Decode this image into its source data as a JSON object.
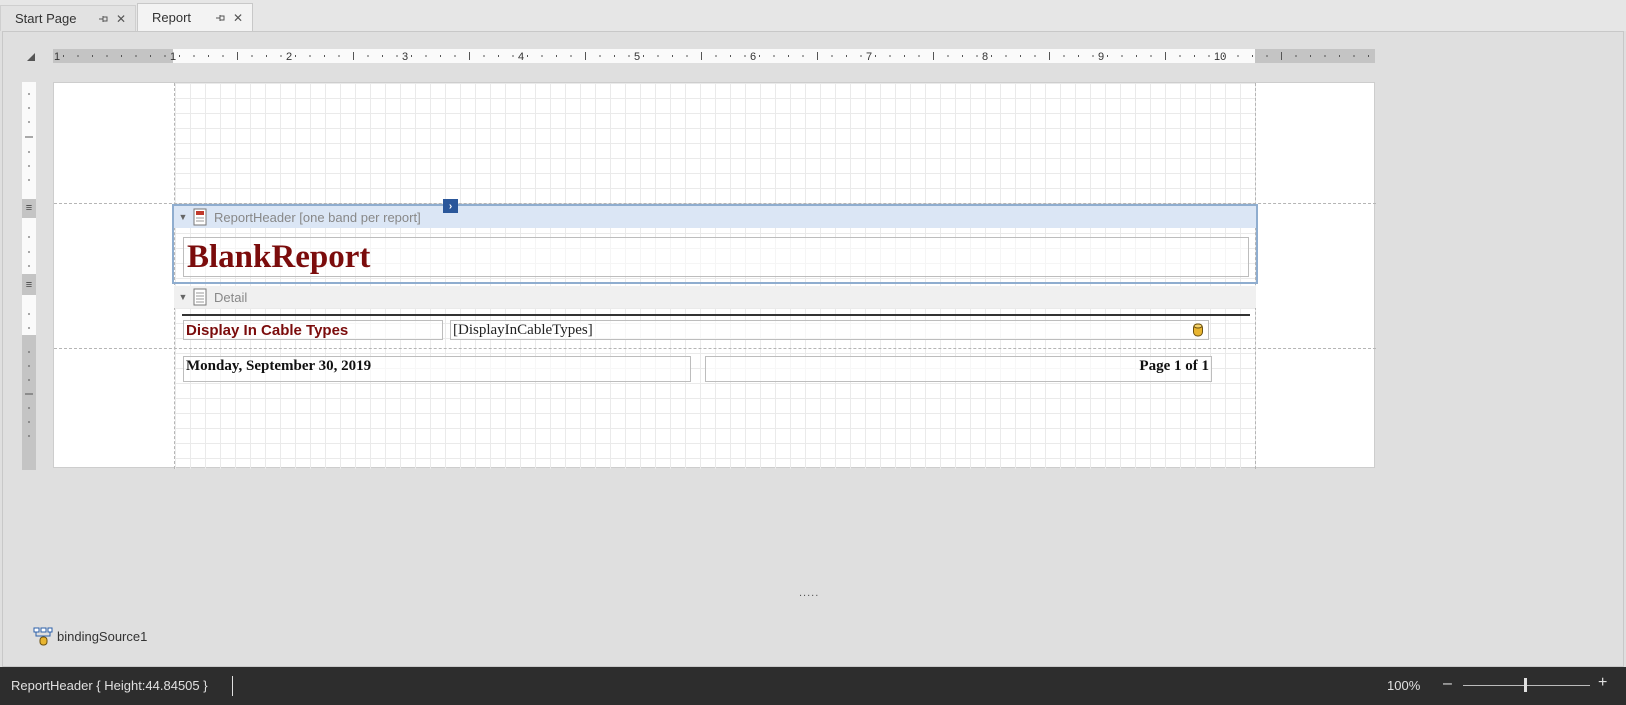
{
  "tabs": [
    {
      "label": "Start Page",
      "active": false
    },
    {
      "label": "Report",
      "active": true
    }
  ],
  "ruler": {
    "horizontal_numbers": [
      "1",
      "1",
      "2",
      "3",
      "4",
      "5",
      "6",
      "7",
      "8",
      "9",
      "10"
    ]
  },
  "bands": {
    "report_header": {
      "label": "ReportHeader [one band per report]"
    },
    "detail": {
      "label": "Detail"
    }
  },
  "report": {
    "title": "BlankReport",
    "caption": "Display In Cable Types",
    "field": "[DisplayInCableTypes]",
    "date": "Monday, September 30, 2019",
    "page_info": "Page 1 of 1"
  },
  "component_tray": {
    "items": [
      {
        "label": "bindingSource1"
      }
    ]
  },
  "resize_handle": ".....",
  "statusbar": {
    "selection": "ReportHeader { Height:44.84505 }",
    "zoom": "100%",
    "zoom_level": 1.0,
    "minus": "–",
    "plus": "+"
  },
  "colors": {
    "title": "#7b0c0c",
    "band_selected": "#dbe6f5",
    "smart_tag": "#2b579a"
  },
  "icons": [
    "pin-icon",
    "close-icon",
    "report-header-band-icon",
    "detail-band-icon",
    "smart-tag-icon",
    "database-field-icon",
    "binding-source-icon",
    "collapse-triangle-icon"
  ]
}
